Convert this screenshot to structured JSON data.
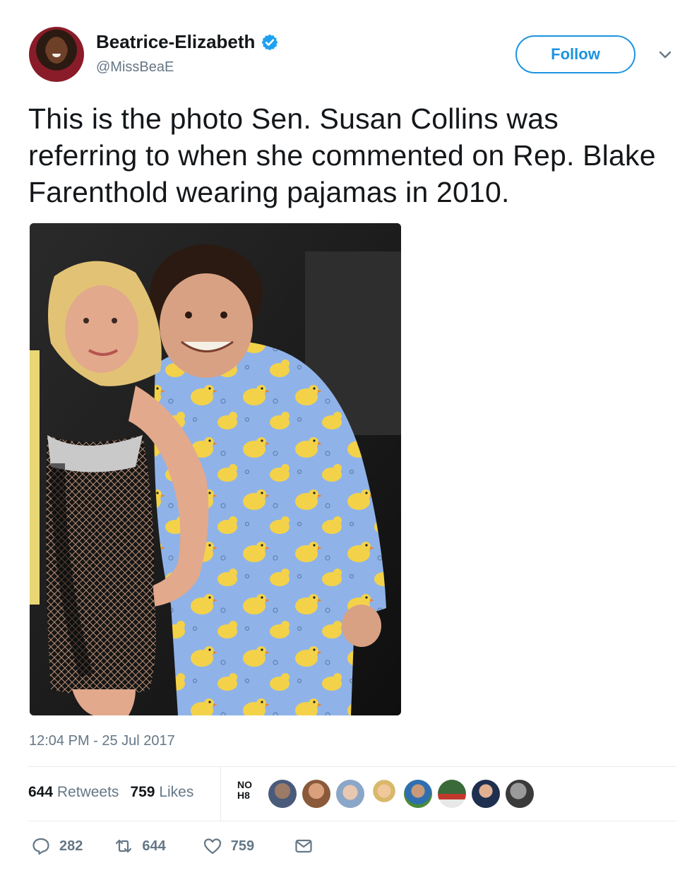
{
  "author": {
    "display_name": "Beatrice-Elizabeth",
    "handle": "@MissBeaE",
    "verified": true
  },
  "follow_button": {
    "label": "Follow"
  },
  "tweet": {
    "text": "This is the photo Sen. Susan Collins was referring to when she commented on Rep. Blake Farenthold wearing pajamas in 2010.",
    "timestamp": "12:04 PM - 25 Jul 2017"
  },
  "stats": {
    "retweets_count": "644",
    "retweets_label": "Retweets",
    "likes_count": "759",
    "likes_label": "Likes"
  },
  "noh8_badge": {
    "line1": "NO",
    "line2": "H8"
  },
  "actions": {
    "reply_count": "282",
    "retweet_count": "644",
    "like_count": "759"
  },
  "colors": {
    "accent": "#1c94e0",
    "verified": "#1da1f2",
    "text_primary": "#14171a",
    "text_secondary": "#657786",
    "divider": "#e6ecf0"
  },
  "icons": [
    "verified-badge-icon",
    "chevron-down-icon",
    "reply-icon",
    "retweet-icon",
    "heart-icon",
    "direct-message-icon"
  ]
}
